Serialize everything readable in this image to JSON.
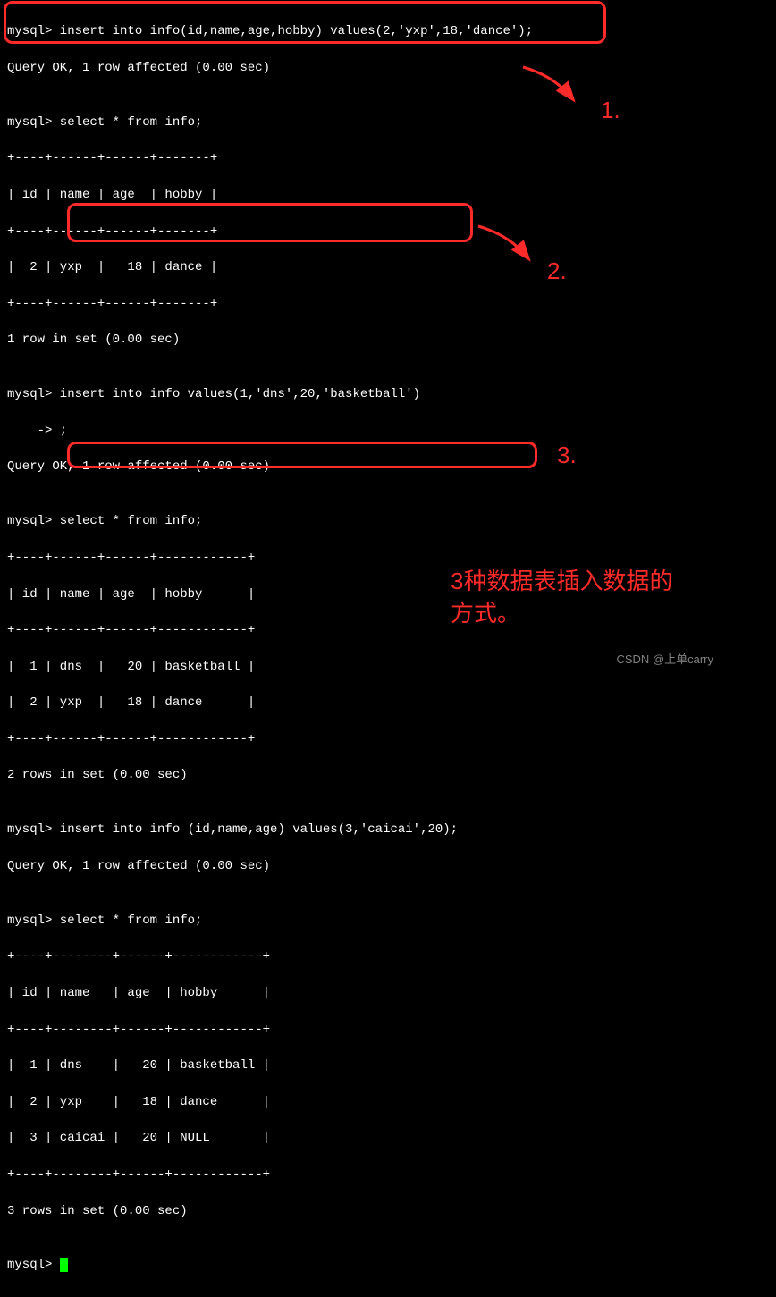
{
  "lines": {
    "l1": "mysql> insert into info(id,name,age,hobby) values(2,'yxp',18,'dance');",
    "l2": "Query OK, 1 row affected (0.00 sec)",
    "l3": "",
    "l4": "mysql> select * from info;",
    "l5": "+----+------+------+-------+",
    "l6": "| id | name | age  | hobby |",
    "l7": "+----+------+------+-------+",
    "l8": "|  2 | yxp  |   18 | dance |",
    "l9": "+----+------+------+-------+",
    "l10": "1 row in set (0.00 sec)",
    "l11": "",
    "l12": "mysql> insert into info values(1,'dns',20,'basketball')",
    "l13": "    -> ;",
    "l14": "Query OK, 1 row affected (0.00 sec)",
    "l15": "",
    "l16": "mysql> select * from info;",
    "l17": "+----+------+------+------------+",
    "l18": "| id | name | age  | hobby      |",
    "l19": "+----+------+------+------------+",
    "l20": "|  1 | dns  |   20 | basketball |",
    "l21": "|  2 | yxp  |   18 | dance      |",
    "l22": "+----+------+------+------------+",
    "l23": "2 rows in set (0.00 sec)",
    "l24": "",
    "l25": "mysql> insert into info (id,name,age) values(3,'caicai',20);",
    "l26": "Query OK, 1 row affected (0.00 sec)",
    "l27": "",
    "l28": "mysql> select * from info;",
    "l29": "+----+--------+------+------------+",
    "l30": "| id | name   | age  | hobby      |",
    "l31": "+----+--------+------+------------+",
    "l32": "|  1 | dns    |   20 | basketball |",
    "l33": "|  2 | yxp    |   18 | dance      |",
    "l34": "|  3 | caicai |   20 | NULL       |",
    "l35": "+----+--------+------+------------+",
    "l36": "3 rows in set (0.00 sec)",
    "l37": "",
    "l38": "mysql> "
  },
  "annotations": {
    "a1": "1.",
    "a2": "2.",
    "a3": "3.",
    "note_line1": "3种数据表插入数据的",
    "note_line2": "方式。"
  },
  "watermark": "CSDN @上单carry"
}
